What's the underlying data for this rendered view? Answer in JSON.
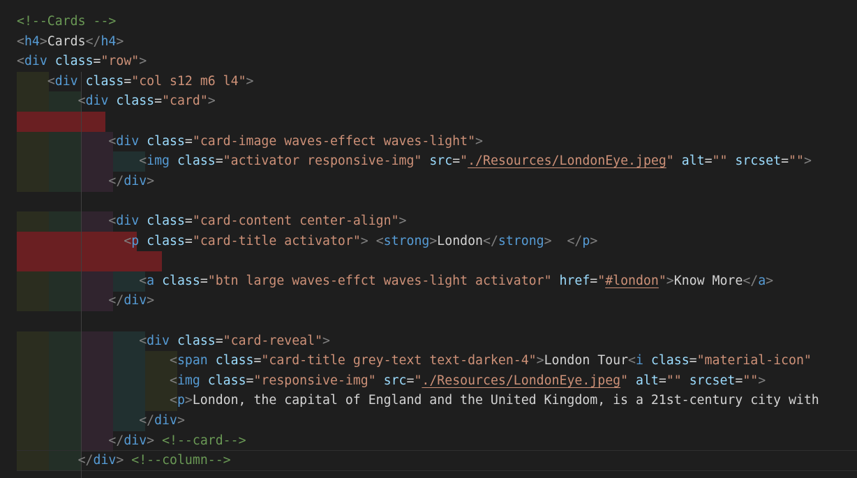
{
  "editor": {
    "language": "html",
    "theme": "dark",
    "lines": [
      "<!--Cards -->",
      "<h4>Cards</h4>",
      "<div class=\"row\">",
      "    <div class=\"col s12 m6 l4\">",
      "        <div class=\"card\">",
      "",
      "            <div class=\"card-image waves-effect waves-light\">",
      "                <img class=\"activator responsive-img\" src=\"./Resources/LondonEye.jpeg\" alt=\"\" srcset=\"\">",
      "            </div>",
      "",
      "            <div class=\"card-content center-align\">",
      "              <p class=\"card-title activator\"> <strong>London</strong>  </p>",
      "",
      "                <a class=\"btn large waves-effct waves-light activator\" href=\"#london\">Know More</a>",
      "            </div>",
      "",
      "                <div class=\"card-reveal\">",
      "                    <span class=\"card-title grey-text text-darken-4\">London Tour<i class=\"material-icons",
      "                    <img class=\"responsive-img\" src=\"./Resources/LondonEye.jpeg\" alt=\"\" srcset=\"\">",
      "                    <p>London, the capital of England and the United Kingdom, is a 21st-century city with",
      "                </div>",
      "            </div> <!--card-->",
      "        </div> <!--column-->"
    ]
  },
  "colors": {
    "background": "#1e1e1e",
    "comment": "#6a9955",
    "tag": "#569cd6",
    "attribute": "#9cdcfe",
    "string": "#ce9178",
    "text": "#d4d4d4",
    "punctuation": "#808080",
    "indent_level_1": "#2b2d1f",
    "indent_level_2": "#232f27",
    "indent_level_3": "#30242e",
    "indent_level_4": "#213030",
    "indent_error": "#6a1f22"
  }
}
